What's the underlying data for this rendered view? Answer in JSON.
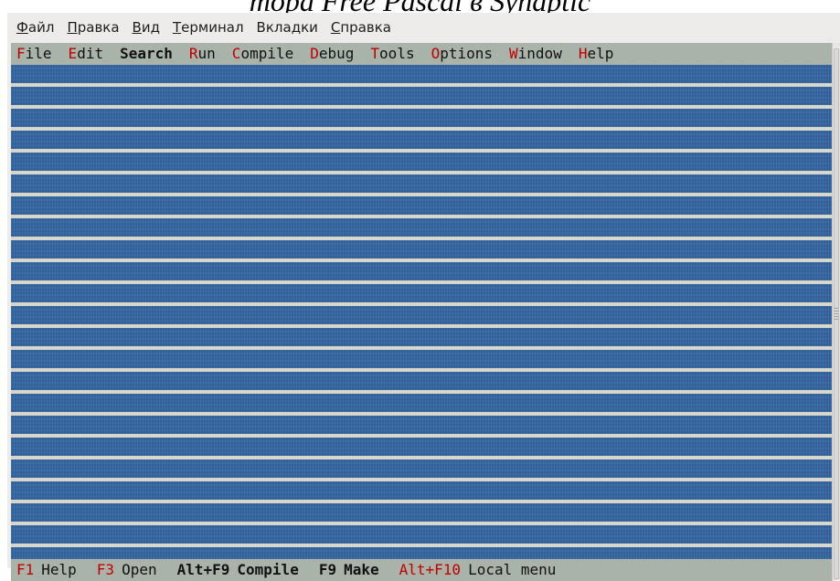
{
  "caption": {
    "text": "тора Free Pascal в Synaptic"
  },
  "terminal": {
    "menubar": [
      {
        "mnemonic": "Ф",
        "rest": "айл"
      },
      {
        "mnemonic": "П",
        "rest": "равка"
      },
      {
        "mnemonic": "В",
        "rest": "ид"
      },
      {
        "mnemonic": "Т",
        "rest": "ерминал"
      },
      {
        "before": "Вкла",
        "mnemonic": "д",
        "rest": "ки"
      },
      {
        "mnemonic": "С",
        "rest": "правка"
      }
    ]
  },
  "ide": {
    "menubar": [
      {
        "hot": "F",
        "rest": "ile"
      },
      {
        "hot": "E",
        "rest": "dit"
      },
      {
        "hot": "",
        "rest": "Search"
      },
      {
        "hot": "R",
        "rest": "un"
      },
      {
        "hot": "C",
        "rest": "ompile"
      },
      {
        "hot": "D",
        "rest": "ebug"
      },
      {
        "hot": "T",
        "rest": "ools"
      },
      {
        "hot": "O",
        "rest": "ptions"
      },
      {
        "hot": "W",
        "rest": "indow"
      },
      {
        "hot": "H",
        "rest": "elp"
      }
    ],
    "statusbar": [
      {
        "key": "F1",
        "label": "Help"
      },
      {
        "key": "F3",
        "label": "Open"
      },
      {
        "key": "Alt+F9",
        "label": "Compile"
      },
      {
        "key": "F9",
        "label": "Make"
      },
      {
        "key": "Alt+F10",
        "label": "Local menu"
      }
    ]
  },
  "colors": {
    "desktop": "#2e5d93",
    "menubar_bg": "#aab3aa",
    "hotkey": "#c00000"
  }
}
